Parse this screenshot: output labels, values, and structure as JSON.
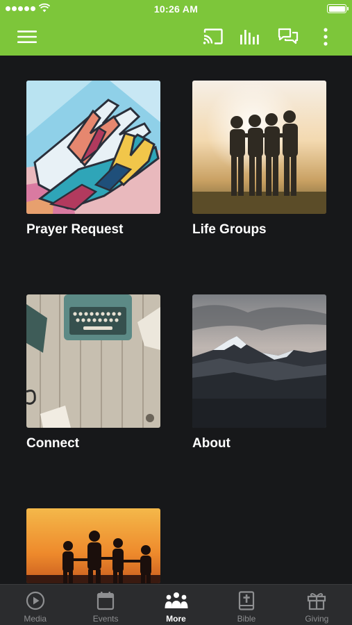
{
  "status_bar": {
    "time": "10:26 AM"
  },
  "app_bar": {
    "icons": [
      "menu-icon",
      "cast-icon",
      "audio-bars-icon",
      "chat-icon",
      "more-vertical-icon"
    ],
    "background": "#7dc63a"
  },
  "grid": {
    "items": [
      {
        "label": "Prayer Request",
        "image": "painted-hands"
      },
      {
        "label": "Life Groups",
        "image": "friends-at-sunset"
      },
      {
        "label": "Connect",
        "image": "typewriter-on-wood"
      },
      {
        "label": "About",
        "image": "snowy-mountains"
      },
      {
        "label": "",
        "image": "family-silhouette-sunset"
      }
    ]
  },
  "tab_bar": {
    "tabs": [
      {
        "label": "Media",
        "icon": "play-circle-icon",
        "active": false
      },
      {
        "label": "Events",
        "icon": "calendar-icon",
        "active": false
      },
      {
        "label": "More",
        "icon": "people-group-icon",
        "active": true
      },
      {
        "label": "Bible",
        "icon": "bible-icon",
        "active": false
      },
      {
        "label": "Giving",
        "icon": "gift-icon",
        "active": false
      }
    ]
  },
  "colors": {
    "accent": "#7dc63a",
    "background": "#17181a",
    "tab_bar": "#2b2c2e",
    "tab_inactive": "#8e8f91"
  }
}
